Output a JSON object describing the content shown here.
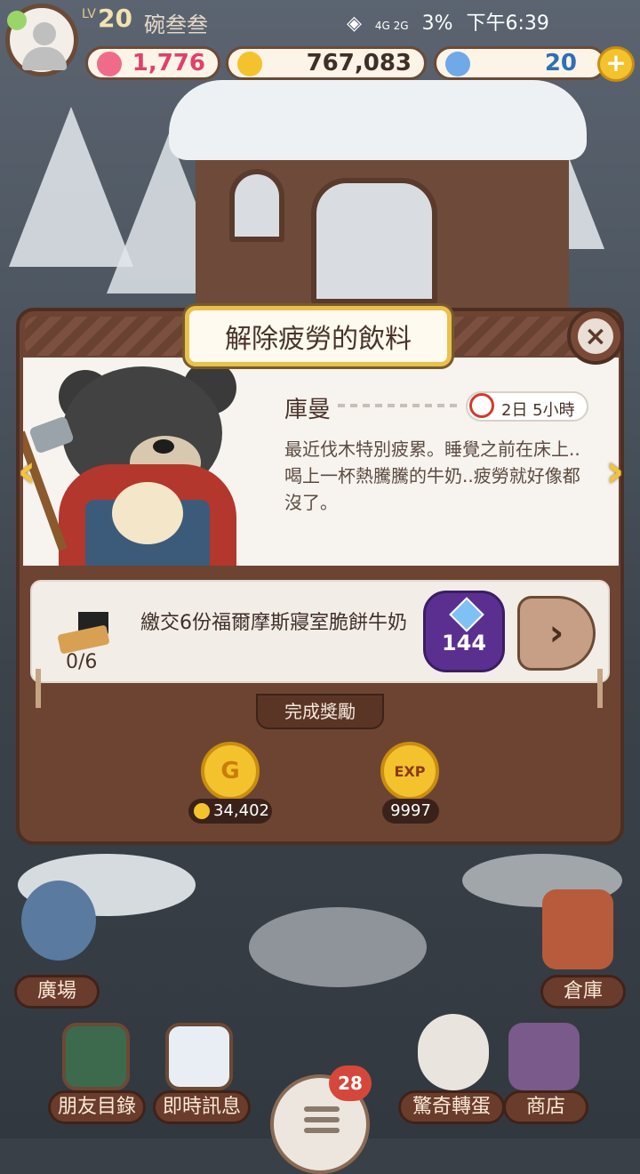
{
  "status_bar": {
    "level_prefix": "LV",
    "level": "20",
    "nickname": "碗叁叁",
    "network": "4G 2G",
    "battery": "3%",
    "clock": "下午6:39"
  },
  "resources": {
    "hearts": "1,776",
    "coins": "767,083",
    "gems": "20",
    "add_label": "+"
  },
  "quest": {
    "title": "解除疲勞的飲料",
    "close_label": "×",
    "npc_name": "庫曼",
    "timer": "2日 5小時",
    "description": "最近伐木特別疲累。睡覺之前在床上..喝上一杯熱騰騰的牛奶..疲勞就好像都沒了。",
    "requirement": {
      "text": "繳交6份福爾摩斯寢室脆餅牛奶",
      "progress": "0/6",
      "gem_cost": "144",
      "go_label": "›"
    },
    "nav_prev": "‹",
    "nav_next": "›",
    "reward_header": "完成獎勵",
    "rewards": {
      "coin_icon_label": "G",
      "coin_amount": "34,402",
      "exp_icon_label": "EXP",
      "exp_amount": "9997"
    }
  },
  "bottom_nav": {
    "plaza": "廣場",
    "warehouse": "倉庫",
    "friends": "朋友目錄",
    "messages": "即時訊息",
    "gacha": "驚奇轉蛋",
    "shop": "商店",
    "notification_count": "28"
  },
  "colors": {
    "frame": "#6d4432",
    "title_border": "#e8c24a",
    "gem_button": "#5b2f8f",
    "badge": "#d6473b"
  }
}
